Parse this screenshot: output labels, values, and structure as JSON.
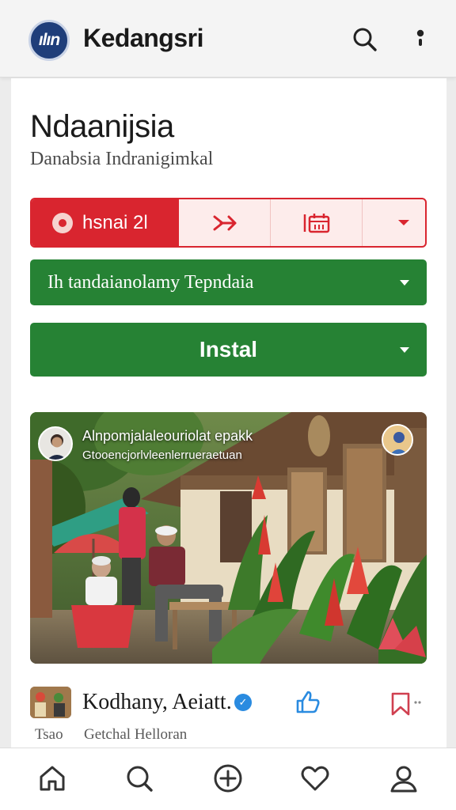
{
  "header": {
    "logo_text": "ılın",
    "app_title": "Kedangsri",
    "search_icon": "search-icon",
    "more_icon": "more-vertical-icon"
  },
  "page": {
    "title": "Ndaanijsia",
    "subtitle": "Danabsia Indranigimkal"
  },
  "tabs": {
    "active_label": "hsnai 2l",
    "items": [
      {
        "icon": "share-arrow-icon"
      },
      {
        "icon": "calendar-icon"
      },
      {
        "icon": "chevron-down-icon"
      }
    ]
  },
  "select": {
    "value": "Ih tandaianolamy Tepndaia"
  },
  "install": {
    "label": "Instal"
  },
  "post": {
    "image_title": "Alnpomjalaleouriolat epakk",
    "image_subtitle": "Gtooencjorlvleenlerrueraetuan",
    "author_name": "Kodhany, Aeiatt.",
    "meta_left": "Tsao",
    "meta_right": "Getchal Helloran"
  },
  "bottom_nav": [
    {
      "name": "home",
      "icon": "home-icon"
    },
    {
      "name": "search",
      "icon": "search-icon"
    },
    {
      "name": "create",
      "icon": "add-circle-icon"
    },
    {
      "name": "favorites",
      "icon": "heart-icon"
    },
    {
      "name": "profile",
      "icon": "user-icon"
    }
  ],
  "colors": {
    "brand_red": "#d9252f",
    "brand_green": "#268234",
    "logo_blue": "#1f3e7a",
    "verified_blue": "#2a8be0"
  }
}
